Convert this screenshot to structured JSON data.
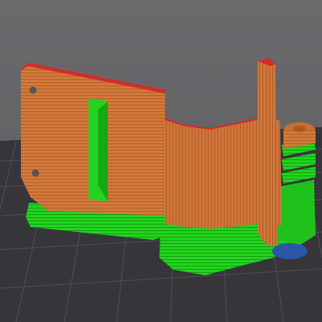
{
  "viewport": {
    "background_color": "#666669",
    "bed_color": "#3a3a3d",
    "grid_line_color": "#525256"
  },
  "model": {
    "feature_colors": {
      "perimeter": "#d27a3c",
      "perimeter_stripe": "#b8612a",
      "skirt_brim": "#22d41e",
      "skirt_brim_dark": "#13a012",
      "top_solid_infill": "#d52a2a",
      "bridge_infill": "#2c55a8"
    },
    "holes": [
      "mounting-hole-top",
      "mounting-hole-bottom"
    ]
  }
}
